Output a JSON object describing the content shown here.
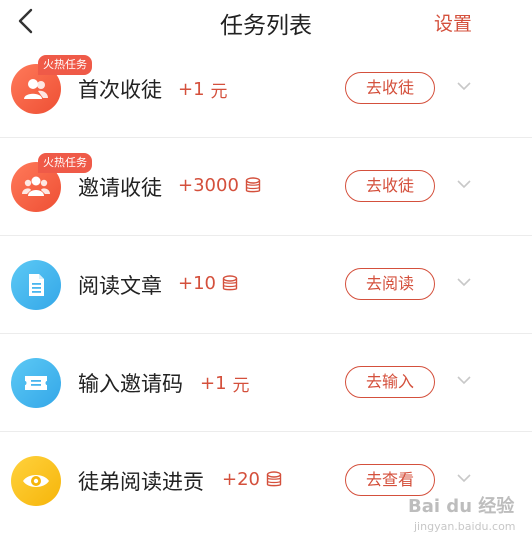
{
  "header": {
    "back_icon": "chevron-left-icon",
    "title": "任务列表",
    "settings_label": "设置"
  },
  "badge_color": "#ef5a48",
  "accent_color": "#d4503c",
  "tasks": [
    {
      "name": "首次收徒",
      "reward": "+1",
      "unit": "元",
      "reward_type": "cash",
      "hot_label": "火热任务",
      "button": "去收徒",
      "icon": "single-user-icon",
      "icon_color": "#ee4f34"
    },
    {
      "name": "邀请收徒",
      "reward": "+3000",
      "unit": "",
      "reward_type": "coin",
      "hot_label": "火热任务",
      "button": "去收徒",
      "icon": "group-users-icon",
      "icon_color": "#ee4f34"
    },
    {
      "name": "阅读文章",
      "reward": "+10",
      "unit": "",
      "reward_type": "coin",
      "hot_label": "",
      "button": "去阅读",
      "icon": "document-icon",
      "icon_color": "#34a7e8"
    },
    {
      "name": "输入邀请码",
      "reward": "+1",
      "unit": "元",
      "reward_type": "cash",
      "hot_label": "",
      "button": "去输入",
      "icon": "ticket-icon",
      "icon_color": "#34a7e8"
    },
    {
      "name": "徒弟阅读进贡",
      "reward": "+20",
      "unit": "",
      "reward_type": "coin",
      "hot_label": "",
      "button": "去查看",
      "icon": "eye-icon",
      "icon_color": "#f6b50a"
    }
  ],
  "watermark": {
    "logo": "Bai du 经验",
    "url": "jingyan.baidu.com"
  }
}
